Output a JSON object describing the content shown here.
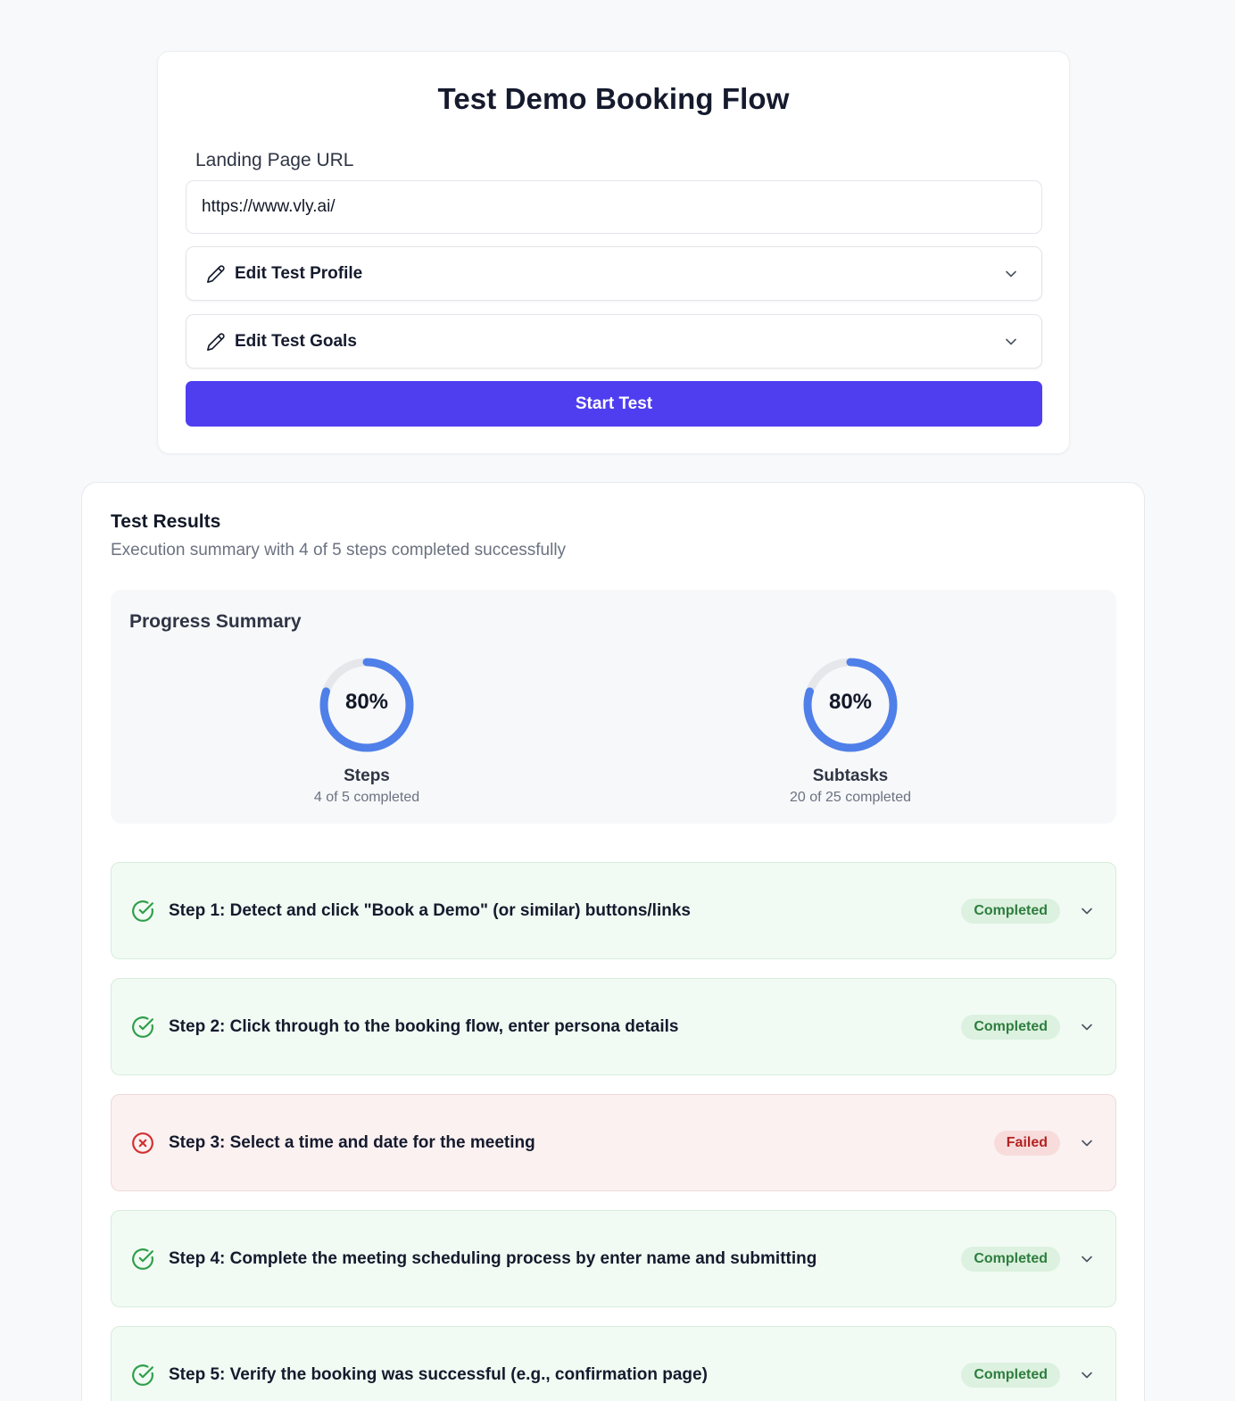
{
  "form": {
    "title": "Test Demo Booking Flow",
    "url_label": "Landing Page URL",
    "url_value": "https://www.vly.ai/",
    "edit_profile_label": "Edit Test Profile",
    "edit_goals_label": "Edit Test Goals",
    "start_button_label": "Start Test"
  },
  "results": {
    "title": "Test Results",
    "subtitle": "Execution summary with 4 of 5 steps completed successfully",
    "progress": {
      "title": "Progress Summary",
      "steps": {
        "percent_text": "80%",
        "fraction": 0.8,
        "label": "Steps",
        "detail": "4 of 5 completed"
      },
      "subtasks": {
        "percent_text": "80%",
        "fraction": 0.8,
        "label": "Subtasks",
        "detail": "20 of 25 completed"
      }
    },
    "step_items": [
      {
        "text": "Step 1: Detect and click \"Book a Demo\" (or similar) buttons/links",
        "status": "Completed"
      },
      {
        "text": "Step 2: Click through to the booking flow, enter persona details",
        "status": "Completed"
      },
      {
        "text": "Step 3: Select a time and date for the meeting",
        "status": "Failed"
      },
      {
        "text": "Step 4: Complete the meeting scheduling process by enter name and submitting",
        "status": "Completed"
      },
      {
        "text": "Step 5: Verify the booking was successful (e.g., confirmation page)",
        "status": "Completed"
      }
    ]
  },
  "colors": {
    "accent": "#4f3ef0",
    "ring": "#4f7fe8",
    "ring_track": "#e5e7eb",
    "success": "#2e9e4a",
    "failure": "#d32f2f"
  }
}
